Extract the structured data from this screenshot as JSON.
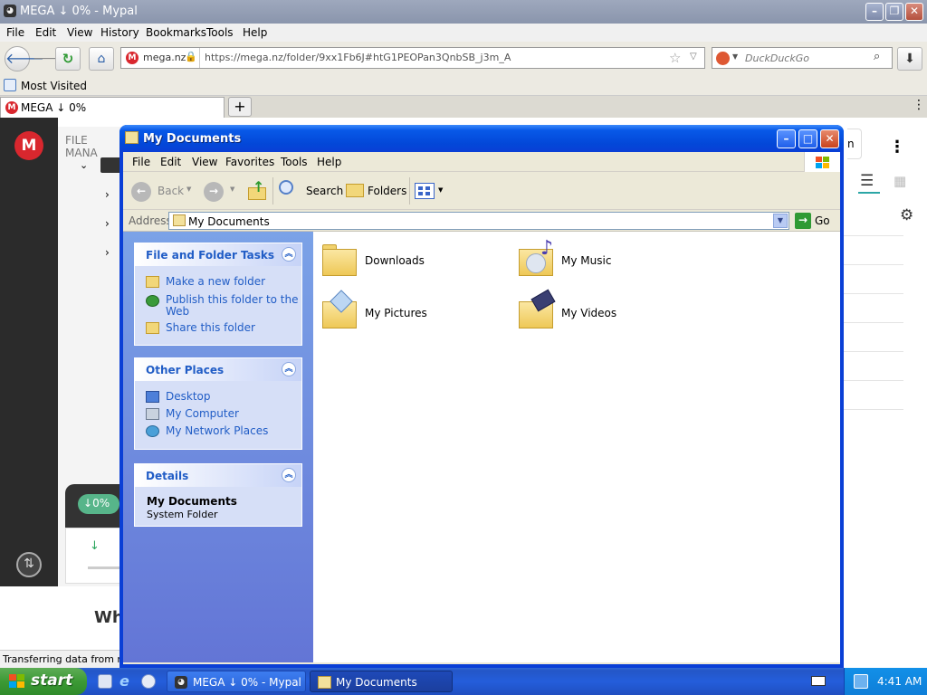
{
  "browser": {
    "title": "MEGA ↓ 0% - Mypal",
    "menu": [
      "File",
      "Edit",
      "View",
      "History",
      "Bookmarks",
      "Tools",
      "Help"
    ],
    "site_identity": "mega.nz",
    "url": "https://mega.nz/folder/9xx1Fb6J#htG1PEOPan3QnbSB_j3m_A",
    "search_placeholder": "DuckDuckGo",
    "bookmark": "Most Visited",
    "tab_title": "MEGA ↓ 0%",
    "new_tab_symbol": "+",
    "status": "Transferring data from mega"
  },
  "mega_page": {
    "file_manager_label": "FILE MANA",
    "transfer_badge": "0%",
    "partial_text": "Wh",
    "partial_right": "n"
  },
  "explorer": {
    "title": "My Documents",
    "menu": [
      "File",
      "Edit",
      "View",
      "Favorites",
      "Tools",
      "Help"
    ],
    "toolbar": {
      "back": "Back",
      "search": "Search",
      "folders": "Folders"
    },
    "address_label": "Address",
    "address_value": "My Documents",
    "go_label": "Go",
    "panels": {
      "tasks": {
        "title": "File and Folder Tasks",
        "links": [
          "Make a new folder",
          "Publish this folder to the Web",
          "Share this folder"
        ]
      },
      "places": {
        "title": "Other Places",
        "links": [
          "Desktop",
          "My Computer",
          "My Network Places"
        ]
      },
      "details": {
        "title": "Details",
        "name": "My Documents",
        "type": "System Folder"
      }
    },
    "items": [
      "Downloads",
      "My Music",
      "My Pictures",
      "My Videos"
    ]
  },
  "taskbar": {
    "start": "start",
    "tasks": [
      "MEGA ↓ 0% - Mypal",
      "My Documents"
    ],
    "clock": "4:41 AM"
  },
  "colors": {
    "xp_blue": "#0a3fd6",
    "mega_red": "#d9272e",
    "link_blue": "#215dc6"
  }
}
